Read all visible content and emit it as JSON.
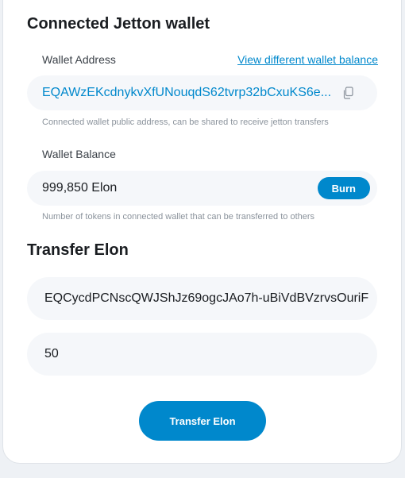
{
  "wallet": {
    "title": "Connected Jetton wallet",
    "address_label": "Wallet Address",
    "view_link": "View different wallet balance",
    "address": "EQAWzEKcdnykvXfUNouqdS62tvrp32bCxuKS6e...",
    "address_helper": "Connected wallet public address, can be shared to receive jetton transfers",
    "balance_label": "Wallet Balance",
    "balance": "999,850 Elon",
    "burn_label": "Burn",
    "balance_helper": "Number of tokens in connected wallet that can be transferred to others",
    "icons": {
      "copy": "copy-icon"
    }
  },
  "transfer": {
    "title": "Transfer Elon",
    "recipient_value": "EQCycdPCNscQWJShJz69ogcJAo7h-uBiVdBVzrvsOuriF",
    "amount_value": "50",
    "button_label": "Transfer Elon"
  },
  "colors": {
    "accent": "#0088cc",
    "field_bg": "#f5f7fa",
    "helper_text": "#8b939c"
  }
}
